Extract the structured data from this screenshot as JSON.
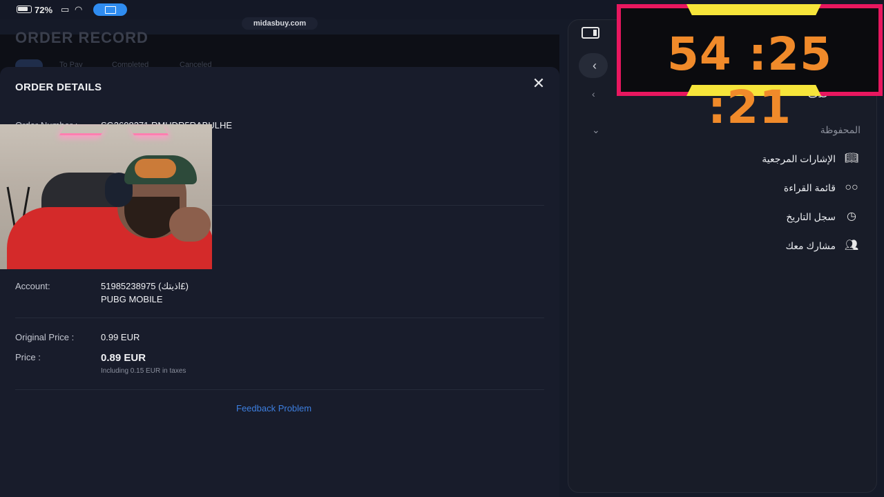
{
  "status_bar": {
    "battery_percent": "72%"
  },
  "browser": {
    "url": "midasbuy.com"
  },
  "background_page": {
    "title": "ORDER RECORD",
    "tabs": [
      "All",
      "To Pay",
      "Completed",
      "Canceled"
    ]
  },
  "modal": {
    "title": "ORDER DETAILS",
    "close_icon": "close-icon",
    "order_number_label": "Order Number :",
    "order_number_value": "SG2608271 RMUDR5RABULHE",
    "account_label": "Account:",
    "account_value": "51985238975 (اذيتك£)",
    "game_name": "PUBG MOBILE",
    "original_price_label": "Original Price :",
    "original_price_value": "0.99 EUR",
    "price_label": "Price :",
    "price_value": "0.89 EUR",
    "tax_note": "Including 0.15 EUR in taxes",
    "feedback_link": "Feedback Problem"
  },
  "side_panel": {
    "top_item_partial": "حذف",
    "section_label": "المحفوظة",
    "items": [
      {
        "label": "الإشارات المرجعية",
        "icon": "book-icon"
      },
      {
        "label": "قائمة القراءة",
        "icon": "glasses-icon"
      },
      {
        "label": "سجل التاريخ",
        "icon": "clock-icon"
      },
      {
        "label": "مشارك معك",
        "icon": "people-icon"
      }
    ]
  },
  "timer_overlay": {
    "value": "54 :25 :21",
    "colors": {
      "border": "#e8175f",
      "accent": "#f6e53a",
      "digits": "#f08a2a"
    }
  }
}
